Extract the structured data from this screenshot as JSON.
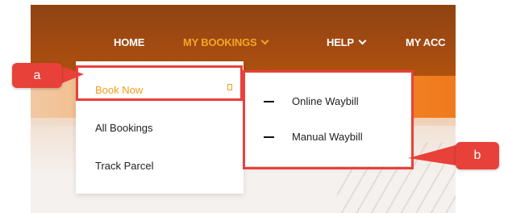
{
  "nav": {
    "home": "HOME",
    "my_bookings": "MY BOOKINGS",
    "help": "HELP",
    "my_account": "MY ACC"
  },
  "dropdown": {
    "items": [
      "Book Now",
      "All Bookings",
      "Track Parcel"
    ]
  },
  "submenu": {
    "items": [
      "Online Waybill",
      "Manual Waybill"
    ]
  },
  "callouts": {
    "a": "a",
    "b": "b"
  },
  "colors": {
    "nav_bg": "#9a4713",
    "active": "#f5a623",
    "highlight": "#e8413a"
  },
  "icons": [
    "chevron-down-icon",
    "square-icon",
    "dash-icon"
  ]
}
